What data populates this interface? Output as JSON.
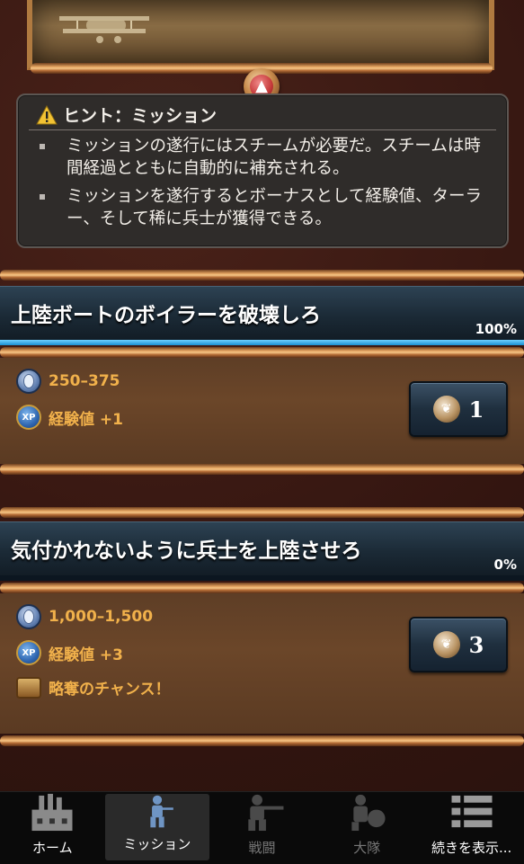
{
  "hint": {
    "title": "ヒント：ミッション",
    "items": [
      "ミッションの遂行にはスチームが必要だ。スチームは時間経過とともに自動的に補充される。",
      "ミッションを遂行するとボーナスとして経験値、ターラー、そして稀に兵士が獲得できる。"
    ]
  },
  "missions": [
    {
      "title": "上陸ボートのボイラーを破壊しろ",
      "percent": "100%",
      "progress": 1.0,
      "coins": "250–375",
      "xp": "経験値 +1",
      "loot": "",
      "steam_cost": "1"
    },
    {
      "title": "気付かれないように兵士を上陸させろ",
      "percent": "0%",
      "progress": 0.0,
      "coins": "1,000–1,500",
      "xp": "経験値 +3",
      "loot": "略奪のチャンス！",
      "steam_cost": "3"
    }
  ],
  "icons": {
    "xp_badge": "XP"
  },
  "nav": {
    "items": [
      {
        "label": "ホーム",
        "icon": "factory-icon",
        "active": false,
        "enabled": true
      },
      {
        "label": "ミッション",
        "icon": "soldier-icon",
        "active": true,
        "enabled": true
      },
      {
        "label": "戦闘",
        "icon": "rifleman-icon",
        "active": false,
        "enabled": false
      },
      {
        "label": "大隊",
        "icon": "squad-icon",
        "active": false,
        "enabled": false
      },
      {
        "label": "続きを表示...",
        "icon": "list-icon",
        "active": false,
        "enabled": true
      }
    ]
  },
  "colors": {
    "reward_text": "#f1b14b",
    "progress_fill": "#1a8fd0",
    "header_bg": "#1b2a36"
  }
}
